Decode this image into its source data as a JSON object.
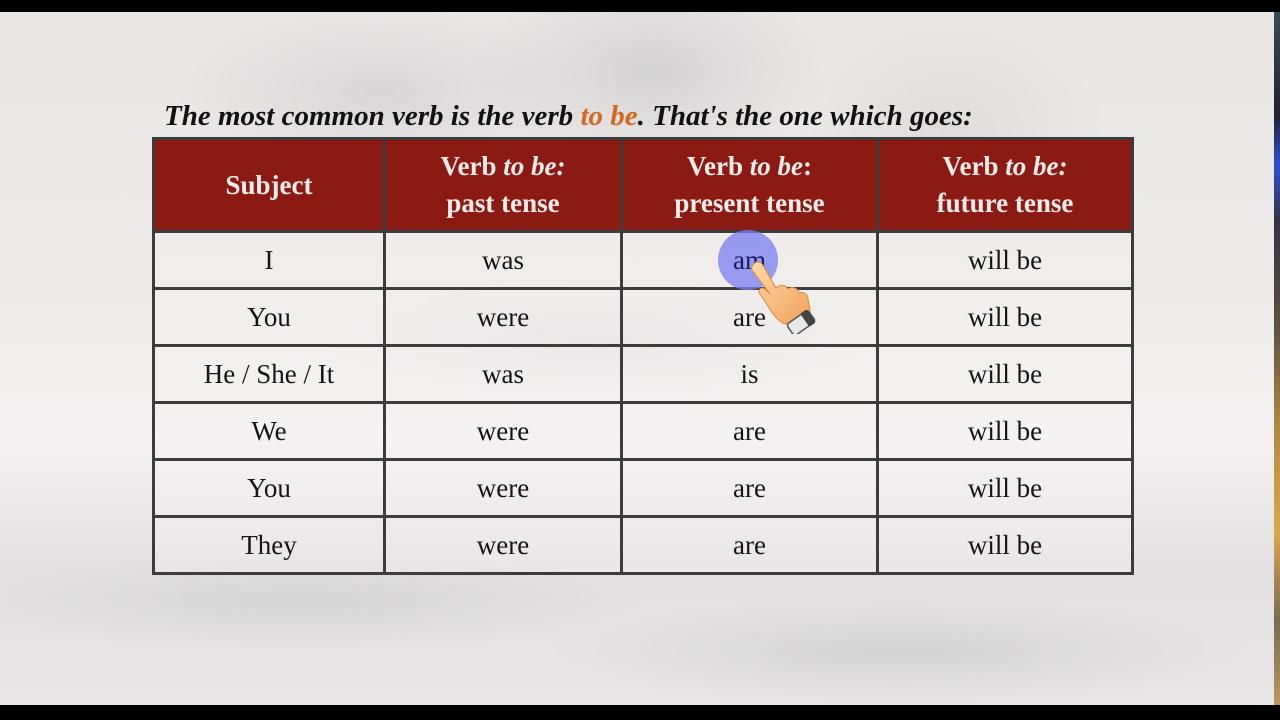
{
  "intro": {
    "before": "The most common verb is the verb ",
    "accent": "to be",
    "after": ". That's the one which goes:",
    "accent_color": "#d2691e"
  },
  "table": {
    "header_color": "#8b1a12",
    "headers": [
      {
        "line1_prefix": "Subject",
        "line1_italic": "",
        "line1_suffix": "",
        "line2": ""
      },
      {
        "line1_prefix": "Verb ",
        "line1_italic": "to be:",
        "line1_suffix": "",
        "line2": "past tense"
      },
      {
        "line1_prefix": "Verb ",
        "line1_italic": "to be",
        "line1_suffix": ":",
        "line2": "present tense"
      },
      {
        "line1_prefix": "Verb ",
        "line1_italic": "to be:",
        "line1_suffix": "",
        "line2": "future tense"
      }
    ],
    "rows": [
      [
        "I",
        "was",
        "am",
        "will be"
      ],
      [
        "You",
        "were",
        "are",
        "will be"
      ],
      [
        "He / She / It",
        "was",
        "is",
        "will be"
      ],
      [
        "We",
        "were",
        "are",
        "will be"
      ],
      [
        "You",
        "were",
        "are",
        "will be"
      ],
      [
        "They",
        "were",
        "are",
        "will be"
      ]
    ],
    "highlighted_cell": {
      "row": 0,
      "col": 2,
      "value": "am"
    }
  }
}
